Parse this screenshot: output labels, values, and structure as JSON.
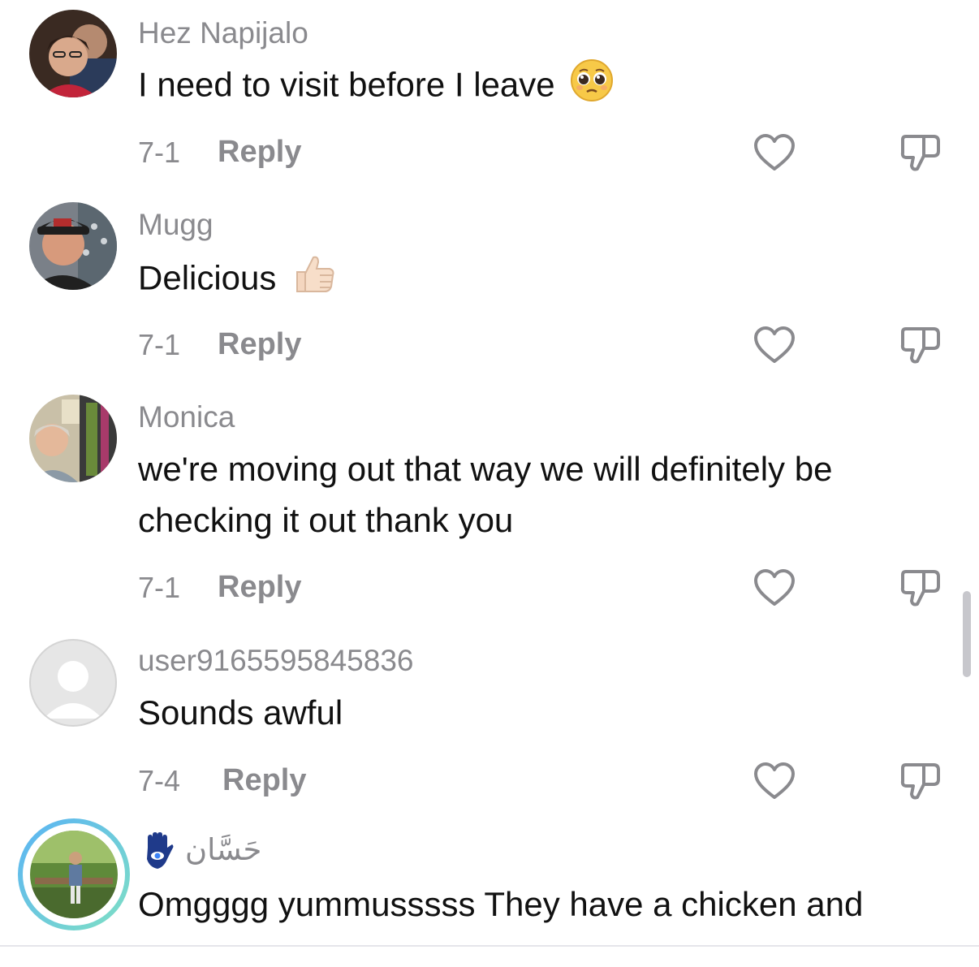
{
  "comments": [
    {
      "username": "Hez Napijalo",
      "text": "I need to visit before I leave",
      "emoji_icon": "pleading-face-icon",
      "date": "7-1",
      "reply_label": "Reply"
    },
    {
      "username": "Mugg",
      "text": "Delicious",
      "emoji_icon": "thumbs-up-icon",
      "date": "7-1",
      "reply_label": "Reply"
    },
    {
      "username": "Monica",
      "text": "we're moving out that way we will definitely be checking it out thank you",
      "date": "7-1",
      "reply_label": "Reply"
    },
    {
      "username": "user9165595845836",
      "text": "Sounds awful",
      "date": "7-4",
      "reply_label": "Reply"
    },
    {
      "username": "حَسَّان",
      "username_icon": "hamsa-hand-icon",
      "text": "Omgggg yummusssss They have a chicken and"
    }
  ],
  "colors": {
    "secondary_text": "#8a8a8e",
    "primary_text": "#111111",
    "story_ring_start": "#5ab3f5",
    "story_ring_end": "#7fe0c4"
  }
}
